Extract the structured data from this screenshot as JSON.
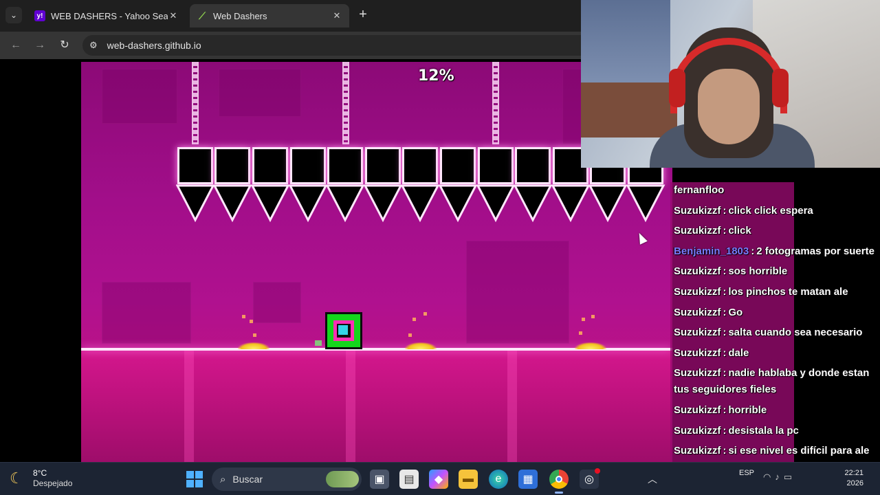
{
  "browser": {
    "tabs": [
      {
        "title": "WEB DASHERS - Yahoo Search T",
        "favicon": "yahoo-icon",
        "active": false
      },
      {
        "title": "Web Dashers",
        "favicon": "web-dashers-icon",
        "active": true
      }
    ],
    "new_tab_label": "+",
    "url": "web-dashers.github.io"
  },
  "game": {
    "progress": "12%",
    "progress_value": 0.12,
    "colors": {
      "background": "#a20e8a",
      "ground": "#d4178d",
      "player": "#14d61c"
    }
  },
  "chat": {
    "messages": [
      {
        "user": "fernanfloo",
        "text": ""
      },
      {
        "user": "Suzukizzf",
        "text": "click click espera"
      },
      {
        "user": "Suzukizzf",
        "text": "click"
      },
      {
        "user": "Benjamin_1803",
        "text": "2 fotogramas por suerte",
        "highlight": true
      },
      {
        "user": "Suzukizzf",
        "text": "sos horrible"
      },
      {
        "user": "Suzukizzf",
        "text": "los pinchos te matan ale"
      },
      {
        "user": "Suzukizzf",
        "text": "Go"
      },
      {
        "user": "Suzukizzf",
        "text": "salta cuando sea necesario"
      },
      {
        "user": "Suzukizzf",
        "text": "dale"
      },
      {
        "user": "Suzukizzf",
        "text": "nadie hablaba y donde estan tus seguidores fieles"
      },
      {
        "user": "Suzukizzf",
        "text": "horrible"
      },
      {
        "user": "Suzukizzf",
        "text": "desistala la pc"
      },
      {
        "user": "Suzukizzf",
        "text": "si ese nivel es difícil para ale no me imagino los que me paso yo"
      }
    ]
  },
  "taskbar": {
    "weather": {
      "temp": "8°C",
      "condition": "Despejado"
    },
    "search_placeholder": "Buscar",
    "language": "ESP",
    "time": "22:21",
    "date": "2026"
  }
}
